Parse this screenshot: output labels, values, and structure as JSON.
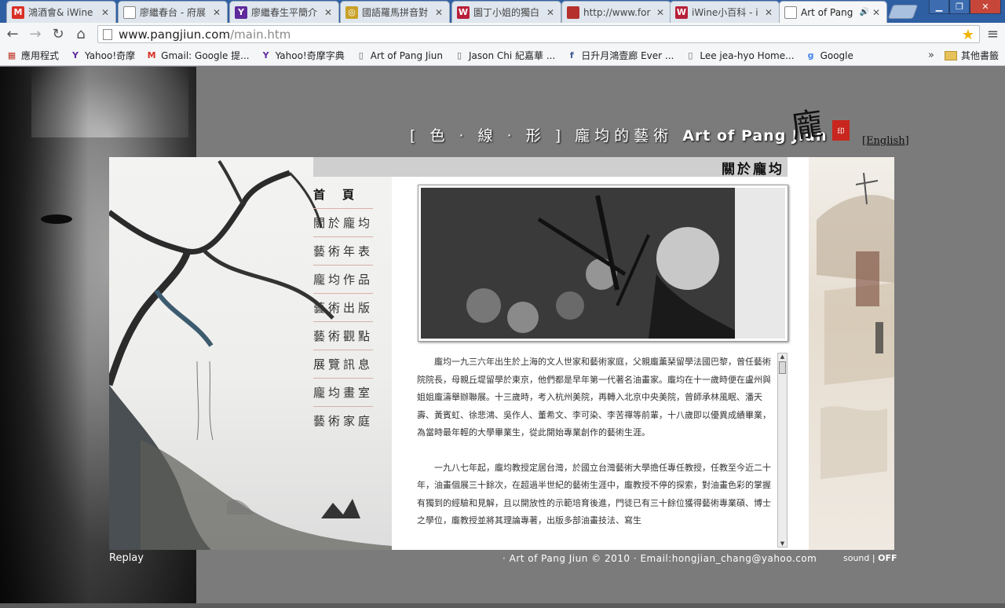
{
  "browser": {
    "tabs": [
      {
        "label": "鴻酒會& iWine",
        "icon": "M",
        "icon_color": "#d93025",
        "active": false
      },
      {
        "label": "廖繼春台 - 府展",
        "icon": "",
        "icon_color": "#ffffff",
        "active": false
      },
      {
        "label": "廖繼春生平簡介",
        "icon": "Y",
        "icon_color": "#5f2a9c",
        "active": false
      },
      {
        "label": "國語羅馬拼音對",
        "icon": "◎",
        "icon_color": "#c9a227",
        "active": false
      },
      {
        "label": "園丁小姐的獨白",
        "icon": "W",
        "icon_color": "#b8203a",
        "active": false
      },
      {
        "label": "http://www.for",
        "icon": "",
        "icon_color": "#b5312b",
        "active": false
      },
      {
        "label": "iWine小百科 - i",
        "icon": "W",
        "icon_color": "#b8203a",
        "active": false
      },
      {
        "label": "Art of Pang",
        "icon": "",
        "icon_color": "#ffffff",
        "active": true
      }
    ],
    "url_host": "www.pangjiun.com",
    "url_path": "/main.htm",
    "bookmarks": [
      {
        "label": "應用程式",
        "icon": "grid"
      },
      {
        "label": "Yahoo!奇摩",
        "icon": "Y"
      },
      {
        "label": "Gmail: Google 提...",
        "icon": "M"
      },
      {
        "label": "Yahoo!奇摩字典",
        "icon": "Y"
      },
      {
        "label": "Art of Pang Jiun",
        "icon": "page"
      },
      {
        "label": "Jason Chi 紀嘉華 ...",
        "icon": "page"
      },
      {
        "label": "日升月鴻壹廊 Ever ...",
        "icon": "f"
      },
      {
        "label": "Lee jea-hyo Home...",
        "icon": "page"
      },
      {
        "label": "Google",
        "icon": "g"
      }
    ],
    "bookmarks_more": "»",
    "other_bookmarks": "其他書籤"
  },
  "site": {
    "title_cn": "[ 色 · 線 · 形 ] 龐均的藝術",
    "title_en": "Art of Pang Jiun",
    "english_link": "[English]",
    "panel_title": "關於龐均",
    "nav": [
      "首頁",
      "關於龐均",
      "藝術年表",
      "龐均作品",
      "藝術出版",
      "藝術觀點",
      "展覽訊息",
      "龐均畫室",
      "藝術家庭"
    ],
    "bio_paragraphs": [
      "龐均一九三六年出生於上海的文人世家和藝術家庭，父親龐薰琹留學法國巴黎，曾任藝術院院長，母親丘堤留學於東京，他們都是早年第一代著名油畫家。龐均在十一歲時便在盧州與姐姐龐濤舉辦聯展。十三歲時，考入杭州美院，再轉入北京中央美院，曾師承林風眠、潘天壽、黃賓虹、徐悲鴻、吳作人、董希文、李可染、李苦禪等前輩，十八歲即以優異成績畢業，為當時最年輕的大學畢業生，從此開始專業創作的藝術生涯。",
      "一九八七年起，龐均教授定居台灣，於國立台灣藝術大學擔任專任教授，任教至今近二十年，油畫個展三十餘次，在超過半世紀的藝術生涯中，龐教授不停的探索，對油畫色彩的掌握有獨到的經驗和見解，且以開放性的示範培育後進，門徒已有三十餘位獲得藝術專業碩、博士之學位，龐教授並將其理論專著，出版多部油畫技法、寫生"
    ],
    "replay": "Replay",
    "footer": "· Art of Pang Jiun © 2010  · Email:hongjian_chang@yahoo.com",
    "sound_label": "sound |",
    "sound_state": "OFF"
  }
}
